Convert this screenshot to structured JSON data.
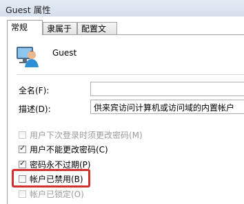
{
  "window": {
    "title": "Guest 属性"
  },
  "tabs": [
    {
      "label": "常规"
    },
    {
      "label": "隶属于"
    },
    {
      "label": "配置文件"
    }
  ],
  "user": {
    "name": "Guest"
  },
  "fields": {
    "fullname_label": "全名(F):",
    "fullname_value": "",
    "description_label": "描述(D):",
    "description_value": "供来宾访问计算机或访问域的内置帐户"
  },
  "options": [
    {
      "label": "用户下次登录时须更改密码(M)",
      "checked": false,
      "enabled": false
    },
    {
      "label": "用户不能更改密码(C)",
      "checked": true,
      "enabled": true
    },
    {
      "label": "密码永不过期(P)",
      "checked": true,
      "enabled": true
    },
    {
      "label": "帐户已禁用(B)",
      "checked": false,
      "enabled": true
    },
    {
      "label": "帐户已锁定(O)",
      "checked": false,
      "enabled": false
    }
  ],
  "colors": {
    "highlight": "#d32f2f",
    "titlebar": "#dbe4ef"
  }
}
